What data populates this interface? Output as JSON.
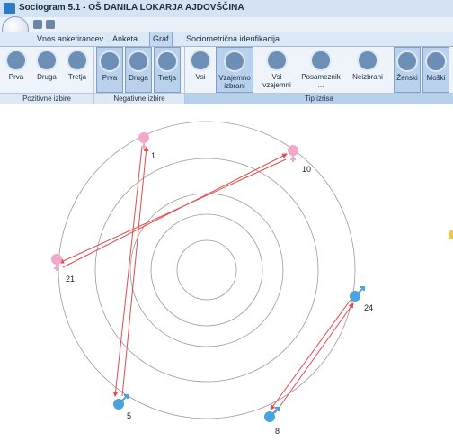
{
  "window": {
    "title": "Sociogram 5.1 - OŠ DANILA LOKARJA AJDOVŠČINA"
  },
  "tabs": [
    {
      "label": "Vnos anketirancev",
      "active": false
    },
    {
      "label": "Anketa",
      "active": false
    },
    {
      "label": "Graf",
      "active": true
    },
    {
      "label": "Sociometrična idenfikacija",
      "active": false
    }
  ],
  "ribbon": {
    "groups": {
      "positive": "Pozitivne izbire",
      "negative": "Negativne izbire",
      "tip": "Tip izrisa"
    },
    "positive_buttons": [
      "Prva",
      "Druga",
      "Tretja"
    ],
    "negative_buttons": [
      "Prva",
      "Druga",
      "Tretja"
    ],
    "tip_buttons": [
      "Vsi",
      "Vzajemno izbrani",
      "Vsi vzajemni",
      "Posameznik ...",
      "Neizbrani"
    ],
    "gender_buttons": [
      "Ženski",
      "Moški"
    ]
  },
  "graph": {
    "nodes": [
      {
        "id": "1",
        "gender": "female"
      },
      {
        "id": "10",
        "gender": "female"
      },
      {
        "id": "21",
        "gender": "female"
      },
      {
        "id": "24",
        "gender": "male"
      },
      {
        "id": "5",
        "gender": "male"
      },
      {
        "id": "8",
        "gender": "male"
      }
    ],
    "edges": [
      {
        "from": "1",
        "to": "5",
        "type": "mutual"
      },
      {
        "from": "10",
        "to": "21",
        "type": "mutual"
      },
      {
        "from": "24",
        "to": "8",
        "type": "mutual"
      }
    ],
    "colors": {
      "edge": "#e24b4b",
      "ring": "#9b9b9b",
      "female": "#f4a7c9",
      "male": "#4aa3df"
    }
  }
}
